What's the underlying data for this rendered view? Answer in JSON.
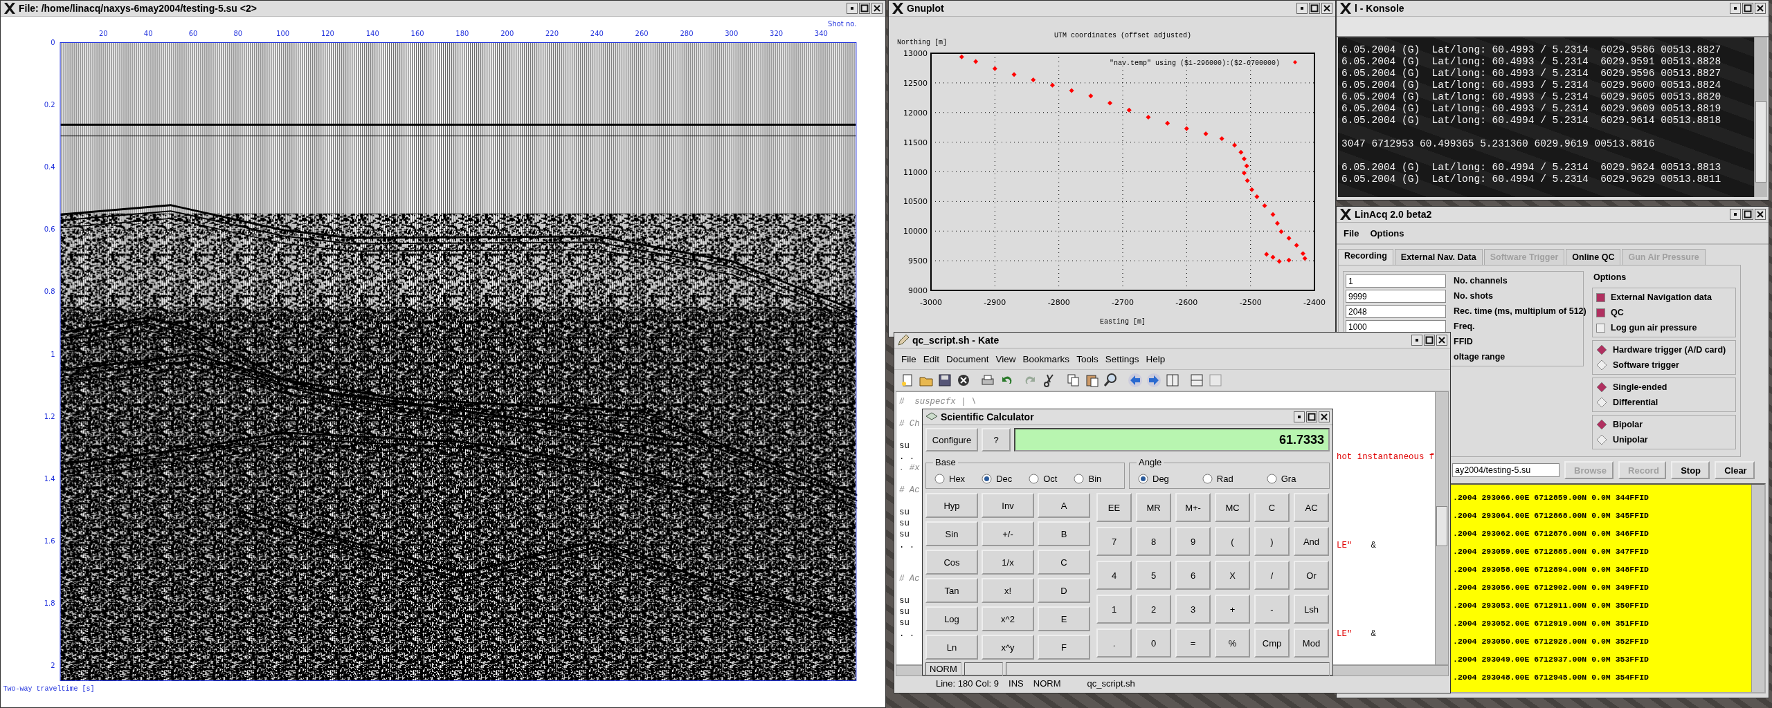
{
  "seismic_window": {
    "title": "File: /home/linacq/naxys-6may2004/testing-5.su <2>",
    "x_axis_label": "Shot no.",
    "x_ticks": [
      "20",
      "40",
      "60",
      "80",
      "100",
      "120",
      "140",
      "160",
      "180",
      "200",
      "220",
      "240",
      "260",
      "280",
      "300",
      "320",
      "340"
    ],
    "y_ticks": [
      "0",
      "0.2",
      "0.4",
      "0.6",
      "0.8",
      "1",
      "1.2",
      "1.4",
      "1.6",
      "1.8",
      "2"
    ],
    "y_axis_label": "Two-way traveltime [s]"
  },
  "konsole_window": {
    "title": "l - Konsole",
    "blocks": [
      [
        "6.05.2004 (G)  Lat/long: 60.4993 / 5.2314  6029.9586 00513.8827",
        "6.05.2004 (G)  Lat/long: 60.4993 / 5.2314  6029.9591 00513.8828",
        "6.05.2004 (G)  Lat/long: 60.4993 / 5.2314  6029.9596 00513.8827",
        "6.05.2004 (G)  Lat/long: 60.4993 / 5.2314  6029.9600 00513.8824",
        "6.05.2004 (G)  Lat/long: 60.4993 / 5.2314  6029.9605 00513.8820",
        "6.05.2004 (G)  Lat/long: 60.4993 / 5.2314  6029.9609 00513.8819",
        "6.05.2004 (G)  Lat/long: 60.4994 / 5.2314  6029.9614 00513.8818"
      ],
      [
        "3047 6712953 60.499365 5.231360 6029.9619 00513.8816"
      ],
      [
        "6.05.2004 (G)  Lat/long: 60.4994 / 5.2314  6029.9624 00513.8813",
        "6.05.2004 (G)  Lat/long: 60.4994 / 5.2314  6029.9629 00513.8811"
      ]
    ]
  },
  "gnuplot_window": {
    "title": "Gnuplot",
    "chart_data": {
      "type": "scatter",
      "title": "UTM coordinates (offset adjusted)",
      "xlabel": "Easting [m]",
      "ylabel": "Northing [m]",
      "xlim": [
        -3000,
        -2400
      ],
      "ylim": [
        9000,
        13000
      ],
      "xticks": [
        -3000,
        -2900,
        -2800,
        -2700,
        -2600,
        -2500,
        -2400
      ],
      "yticks": [
        9000,
        9500,
        10000,
        10500,
        11000,
        11500,
        12000,
        12500,
        13000
      ],
      "grid": true,
      "x": [
        -2952,
        -2930,
        -2900,
        -2870,
        -2840,
        -2810,
        -2780,
        -2750,
        -2720,
        -2690,
        -2660,
        -2630,
        -2600,
        -2570,
        -2545,
        -2525,
        -2515,
        -2510,
        -2506,
        -2510,
        -2505,
        -2498,
        -2490,
        -2478,
        -2465,
        -2458,
        -2452,
        -2440,
        -2428,
        -2418,
        -2415,
        -2440,
        -2455,
        -2465,
        -2475
      ],
      "series": [
        {
          "name": "\"nav.temp\" using ($1-296000):($2-6700000)",
          "color": "#ff0000",
          "values": [
            12940,
            12860,
            12740,
            12640,
            12550,
            12460,
            12370,
            12280,
            12160,
            12040,
            11920,
            11820,
            11730,
            11640,
            11560,
            11450,
            11330,
            11220,
            11100,
            10980,
            10850,
            10700,
            10580,
            10430,
            10280,
            10130,
            9990,
            9880,
            9760,
            9620,
            9540,
            9510,
            9490,
            9560,
            9610
          ]
        }
      ]
    }
  },
  "linacq_window": {
    "title": "LinAcq 2.0 beta2",
    "menu": [
      "File",
      "Options"
    ],
    "tabs": [
      {
        "label": "Recording",
        "selected": true,
        "disabled": false
      },
      {
        "label": "External Nav. Data",
        "selected": false,
        "disabled": false
      },
      {
        "label": "Software Trigger",
        "selected": false,
        "disabled": true
      },
      {
        "label": "Online QC",
        "selected": false,
        "disabled": false
      },
      {
        "label": "Gun Air Pressure",
        "selected": false,
        "disabled": true
      }
    ],
    "fields": [
      {
        "value": "1",
        "label": "No. channels"
      },
      {
        "value": "9999",
        "label": "No. shots"
      },
      {
        "value": "2048",
        "label": "Rec. time (ms, multiplum of 512)"
      },
      {
        "value": "1000",
        "label": "Freq."
      },
      {
        "label": "FFID"
      },
      {
        "label": "oltage range"
      }
    ],
    "options_title": "Options",
    "checkboxes": [
      {
        "label": "External Navigation data",
        "checked": true
      },
      {
        "label": "QC",
        "checked": true
      },
      {
        "label": "Log gun air pressure",
        "checked": false
      }
    ],
    "radio_groups": [
      [
        {
          "label": "Hardware trigger (A/D card)",
          "selected": true
        },
        {
          "label": "Software trigger",
          "selected": false
        }
      ],
      [
        {
          "label": "Single-ended",
          "selected": true
        },
        {
          "label": "Differential",
          "selected": false
        }
      ],
      [
        {
          "label": "Bipolar",
          "selected": true
        },
        {
          "label": "Unipolar",
          "selected": false
        }
      ]
    ],
    "file_path": "ay2004/testing-5.su",
    "buttons": [
      {
        "label": "Browse",
        "disabled": true
      },
      {
        "label": "Record",
        "disabled": true
      },
      {
        "label": "Stop",
        "disabled": false
      },
      {
        "label": "Clear",
        "disabled": false
      }
    ],
    "log_lines": [
      ".2004 293066.00E 6712859.00N 0.0M 344FFID",
      ".2004 293064.00E 6712868.00N 0.0M 345FFID",
      ".2004 293062.00E 6712876.00N 0.0M 346FFID",
      ".2004 293059.00E 6712885.00N 0.0M 347FFID",
      ".2004 293058.00E 6712894.00N 0.0M 348FFID",
      ".2004 293056.00E 6712902.00N 0.0M 349FFID",
      ".2004 293053.00E 6712911.00N 0.0M 350FFID",
      ".2004 293052.00E 6712919.00N 0.0M 351FFID",
      ".2004 293050.00E 6712928.00N 0.0M 352FFID",
      ".2004 293049.00E 6712937.00N 0.0M 353FFID",
      ".2004 293048.00E 6712945.00N 0.0M 354FFID"
    ]
  },
  "kate_window": {
    "title": "qc_script.sh - Kate",
    "menu": [
      "File",
      "Edit",
      "Document",
      "View",
      "Bookmarks",
      "Tools",
      "Settings",
      "Help"
    ],
    "editor_rows": [
      {
        "kind": "comment",
        "left": "#  suspecfx | \\"
      },
      {},
      {
        "kind": "comment",
        "left": "# Ch"
      },
      {},
      {
        "kind": "code",
        "left": "su"
      },
      {
        "kind": "code",
        "left": ". .",
        "right": "hot instantaneous f"
      },
      {
        "kind": "comment",
        "left": ". #x"
      },
      {},
      {
        "kind": "comment",
        "left": "# Ac"
      },
      {},
      {
        "kind": "code",
        "left": "su"
      },
      {
        "kind": "code",
        "left": "su"
      },
      {
        "kind": "code",
        "left": "su"
      },
      {
        "kind": "code",
        "left": ". .",
        "right": "LE\"",
        "tail": "&"
      },
      {},
      {},
      {
        "kind": "comment",
        "left": "# Ac"
      },
      {},
      {
        "kind": "code",
        "left": "su"
      },
      {
        "kind": "code",
        "left": "su"
      },
      {
        "kind": "code",
        "left": "su"
      },
      {
        "kind": "code",
        "left": ". .",
        "right": "LE\"",
        "tail": "&"
      }
    ],
    "status": [
      "Line: 180 Col: 9",
      "INS",
      "NORM",
      "qc_script.sh"
    ]
  },
  "calculator_window": {
    "title": "Scientific Calculator",
    "top_buttons": [
      "Configure",
      "?"
    ],
    "display": "61.7333",
    "base": {
      "title": "Base",
      "options": [
        {
          "label": "Hex",
          "selected": false
        },
        {
          "label": "Dec",
          "selected": true
        },
        {
          "label": "Oct",
          "selected": false
        },
        {
          "label": "Bin",
          "selected": false
        }
      ]
    },
    "angle": {
      "title": "Angle",
      "options": [
        {
          "label": "Deg",
          "selected": true
        },
        {
          "label": "Rad",
          "selected": false
        },
        {
          "label": "Gra",
          "selected": false
        }
      ]
    },
    "left_keys": [
      [
        "Hyp",
        "Inv",
        "A"
      ],
      [
        "Sin",
        "+/-",
        "B"
      ],
      [
        "Cos",
        "1/x",
        "C"
      ],
      [
        "Tan",
        "x!",
        "D"
      ],
      [
        "Log",
        "x^2",
        "E"
      ],
      [
        "Ln",
        "x^y",
        "F"
      ]
    ],
    "right_keys": [
      [
        "EE",
        "MR",
        "M+-",
        "MC",
        "C",
        "AC"
      ],
      [
        "7",
        "8",
        "9",
        "(",
        ")",
        "And"
      ],
      [
        "4",
        "5",
        "6",
        "X",
        "/",
        "Or"
      ],
      [
        "1",
        "2",
        "3",
        "+",
        "-",
        "Lsh"
      ],
      [
        ".",
        "0",
        "=",
        "%",
        "Cmp",
        "Mod"
      ]
    ],
    "status": "NORM"
  }
}
